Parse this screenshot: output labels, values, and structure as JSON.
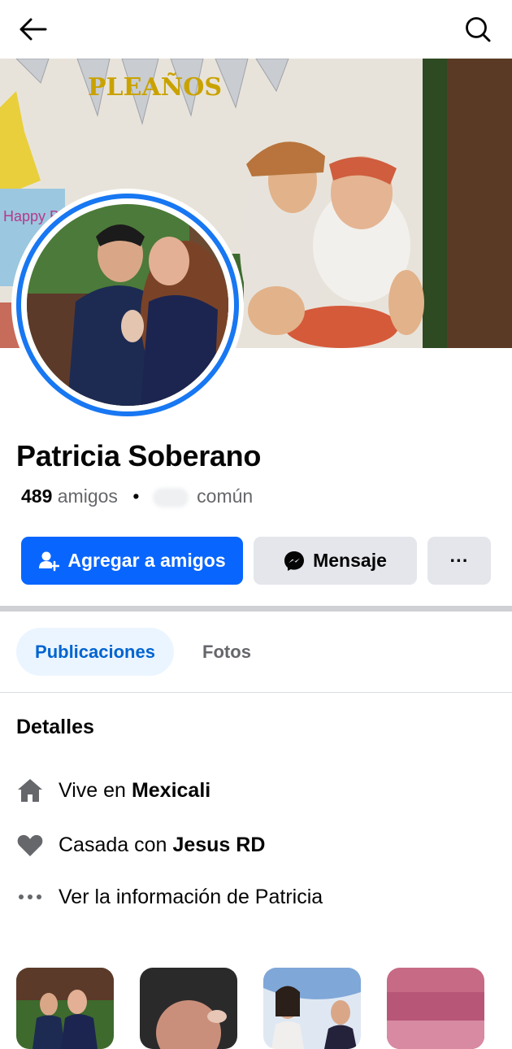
{
  "header": {
    "back_icon": "arrow-left-icon",
    "search_icon": "search-icon"
  },
  "cover": {
    "banner_text": "PLEAÑOS",
    "card_text": "Happy Birth"
  },
  "profile": {
    "name": "Patricia Soberano",
    "friends_count": "489",
    "friends_label": "amigos",
    "separator": "•",
    "mutual_label": "común"
  },
  "actions": {
    "add_friend": "Agregar a amigos",
    "message": "Mensaje",
    "more": "···"
  },
  "tabs": [
    {
      "label": "Publicaciones",
      "active": true
    },
    {
      "label": "Fotos",
      "active": false
    }
  ],
  "details": {
    "title": "Detalles",
    "lives_prefix": "Vive en",
    "lives_value": "Mexicali",
    "relationship_prefix": "Casada con",
    "relationship_value": "Jesus RD",
    "info_link": "Ver la información de Patricia"
  },
  "colors": {
    "primary": "#0866ff",
    "secondary_bg": "#e4e6eb",
    "tab_active_bg": "#ebf5ff",
    "tab_active_text": "#0064d1",
    "muted": "#65676b"
  }
}
